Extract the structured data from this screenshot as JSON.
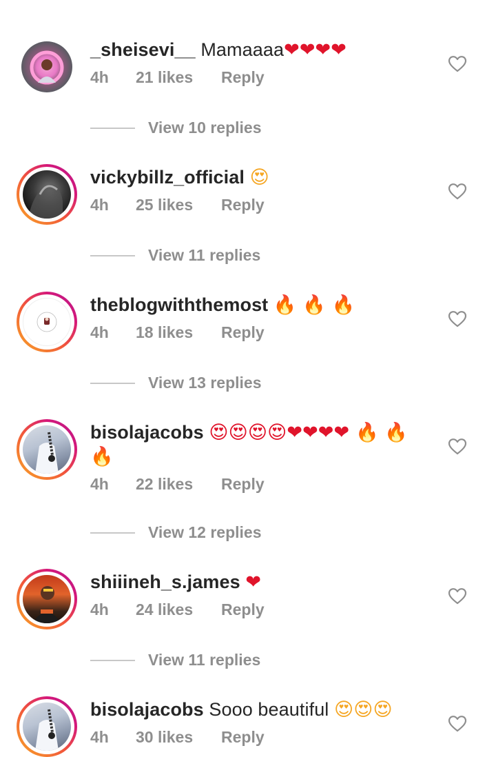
{
  "comments": [
    {
      "username": "_sheisevi__",
      "text": " Mamaaaa",
      "emojis": "❤❤❤❤",
      "time": "4h",
      "likes": "21 likes",
      "reply": "Reply",
      "view_replies": "View 10 replies",
      "has_ring": false
    },
    {
      "username": "vickybillz_official",
      "text": " ",
      "emojis": "😍",
      "time": "4h",
      "likes": "25 likes",
      "reply": "Reply",
      "view_replies": "View 11 replies",
      "has_ring": true
    },
    {
      "username": "theblogwiththemost",
      "text": " ",
      "emojis": "🔥 🔥 🔥",
      "time": "4h",
      "likes": "18 likes",
      "reply": "Reply",
      "view_replies": "View 13 replies",
      "has_ring": true
    },
    {
      "username": "bisolajacobs",
      "text": " ",
      "emojis": "😍😍😍😍❤❤❤❤ 🔥 🔥 🔥",
      "time": "4h",
      "likes": "22 likes",
      "reply": "Reply",
      "view_replies": "View 12 replies",
      "has_ring": true
    },
    {
      "username": "shiiineh_s.james",
      "text": " ",
      "emojis": "❤",
      "time": "4h",
      "likes": "24 likes",
      "reply": "Reply",
      "view_replies": "View 11 replies",
      "has_ring": true
    },
    {
      "username": "bisolajacobs",
      "text": " Sooo beautiful ",
      "emojis": "😍😍😍",
      "time": "4h",
      "likes": "30 likes",
      "reply": "Reply",
      "has_ring": true
    }
  ],
  "colors": {
    "text": "#262626",
    "meta": "#8e8e8e",
    "heart_red": "#e0142b",
    "fire_orange": "#f5a623"
  },
  "icons": {
    "like": "heart-outline-icon"
  }
}
